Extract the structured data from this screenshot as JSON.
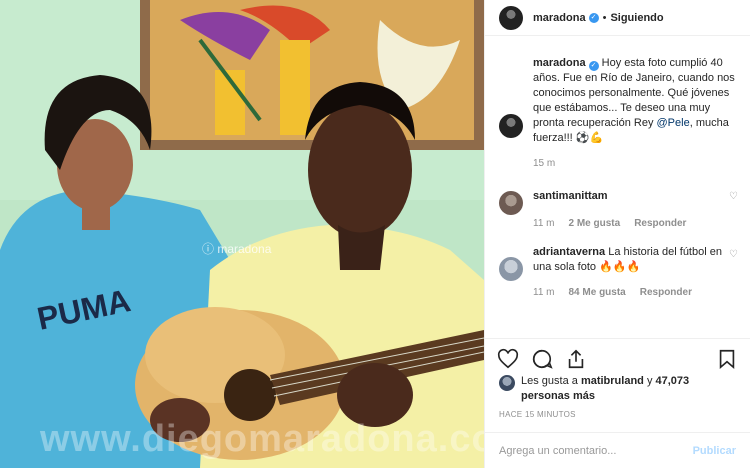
{
  "post": {
    "username": "maradona",
    "verified_mark": "✓",
    "separator": "•",
    "follow_state": "Siguiendo",
    "watermark_handle": "ⓘ maradona",
    "watermark_url": "www.diegomaradona.com"
  },
  "caption": {
    "username": "maradona",
    "text_before": " Hoy esta foto cumplió 40 años. Fue en Río de Janeiro, cuando nos conocimos personalmente. Qué jóvenes que estábamos... Te deseo una muy pronta recuperación Rey ",
    "mention": "@Pele",
    "text_after": ", mucha fuerza!!! ",
    "emojis": "⚽💪",
    "time": "15 m"
  },
  "comments": [
    {
      "username": "santimanittam",
      "text": "",
      "time": "11 m",
      "likes": "2 Me gusta",
      "reply": "Responder"
    },
    {
      "username": "adriantaverna",
      "text": "La historia del fútbol en una sola foto ",
      "emojis": "🔥🔥🔥",
      "time": "11 m",
      "likes": "84 Me gusta",
      "reply": "Responder"
    }
  ],
  "likes": {
    "prefix": "Les gusta a ",
    "user": "matibruland",
    "middle": " y ",
    "others": "47,073 personas más"
  },
  "timestamp": "HACE 15 MINUTOS",
  "add_comment": {
    "placeholder": "Agrega un comentario...",
    "submit_label": "Publicar"
  },
  "icons": [
    "heart-icon",
    "comment-icon",
    "share-icon",
    "bookmark-icon"
  ],
  "colors": {
    "verified": "#3897f0",
    "publish": "#b3dbff",
    "mention": "#003569",
    "meta": "#8e8e8e"
  }
}
